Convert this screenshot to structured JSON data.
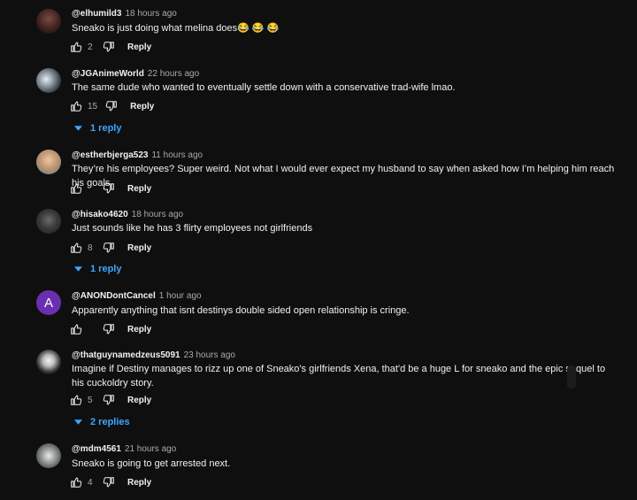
{
  "comments": [
    {
      "handle": "@elhumild3",
      "time": "18 hours ago",
      "text": "Sneako is just doing what melina does😂 😂 😂",
      "likes": "2",
      "reply_label": "Reply"
    },
    {
      "handle": "@JGAnimeWorld",
      "time": "22 hours ago",
      "text": "The same dude who wanted to eventually settle down with a conservative trad-wife lmao.",
      "likes": "15",
      "reply_label": "Reply",
      "replies_label": "1 reply"
    },
    {
      "handle": "@estherbjerga523",
      "time": "11 hours ago",
      "text": "They’re his employees? Super weird. Not what I would ever expect my husband to say when asked how I’m helping him reach his goals.",
      "likes": "",
      "reply_label": "Reply"
    },
    {
      "handle": "@hisako4620",
      "time": "18 hours ago",
      "text": "Just sounds like he has 3 flirty employees not girlfriends",
      "likes": "8",
      "reply_label": "Reply",
      "replies_label": "1 reply"
    },
    {
      "handle": "@ANONDontCancel",
      "time": "1 hour ago",
      "text": "Apparently anything that isnt destinys double sided open relationship is cringe.",
      "likes": "",
      "reply_label": "Reply",
      "avatar_letter": "A"
    },
    {
      "handle": "@thatguynamedzeus5091",
      "time": "23 hours ago",
      "text": "Imagine if Destiny manages to rizz up one of Sneako's girlfriends Xena, that'd be a huge L for sneako and the epic sequel to his cuckoldry story.",
      "likes": "5",
      "reply_label": "Reply",
      "replies_label": "2 replies"
    },
    {
      "handle": "@mdm4561",
      "time": "21 hours ago",
      "text": "Sneako is going to get arrested next.",
      "likes": "4",
      "reply_label": "Reply"
    }
  ],
  "colors": {
    "background": "#0f0f0f",
    "link": "#3ea6ff",
    "muted": "#aaaaaa",
    "avatar_letter_bg": "#6a2fb1"
  },
  "icons": {
    "like": "thumb-up-icon",
    "dislike": "thumb-down-icon",
    "expand": "chevron-down-icon"
  }
}
